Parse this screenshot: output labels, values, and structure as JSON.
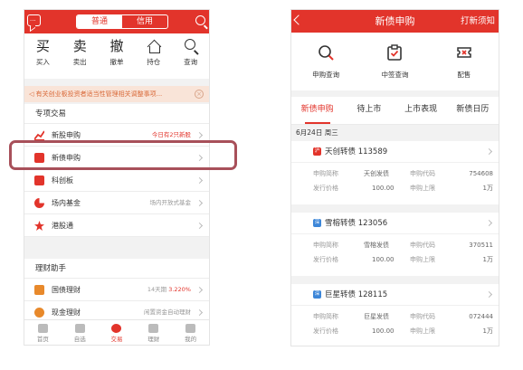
{
  "left": {
    "segments": [
      "普通",
      "信用"
    ],
    "actions": [
      {
        "big": "买",
        "label": "买入"
      },
      {
        "big": "卖",
        "label": "卖出"
      },
      {
        "big": "撤",
        "label": "撤单"
      },
      {
        "big": "",
        "label": "持仓",
        "icon": "house-icon"
      },
      {
        "big": "",
        "label": "查询",
        "icon": "search-icon"
      }
    ],
    "notice": "有关创业板投资者适当性管理相关调整事项...",
    "section1_title": "专项交易",
    "rows1": [
      {
        "label": "新股申购",
        "right": "今日有2只新股",
        "right_red": true,
        "icon": "trend-icon",
        "color": "#e2342b"
      },
      {
        "label": "新债申购",
        "right": "",
        "icon": "bond-icon",
        "color": "#e2342b"
      },
      {
        "label": "科创板",
        "right": "",
        "icon": "star-board-icon",
        "color": "#e2342b"
      },
      {
        "label": "场内基金",
        "right": "场内开放式基金",
        "icon": "pie-icon",
        "color": "#e2342b"
      },
      {
        "label": "港股通",
        "right": "",
        "icon": "bauhinia-icon",
        "color": "#e2342b"
      }
    ],
    "section2_title": "理财助手",
    "rows2": [
      {
        "label": "国债理财",
        "right_prefix": "14天期 ",
        "right_value": "3.220%",
        "icon": "ticket-icon",
        "color": "#e8892b"
      },
      {
        "label": "现金理财",
        "right": "闲置资金自动理财",
        "icon": "coin-icon",
        "color": "#e8892b"
      }
    ],
    "tabs": [
      "首页",
      "自选",
      "交易",
      "理财",
      "我的"
    ],
    "active_tab": "交易"
  },
  "right": {
    "title": "新债申购",
    "header_link": "打新须知",
    "queries": [
      {
        "label": "申购查询",
        "icon": "magnifier-icon"
      },
      {
        "label": "中签查询",
        "icon": "clipboard-check-icon"
      },
      {
        "label": "配售",
        "icon": "ticket-icon"
      }
    ],
    "tabs": [
      "新债申购",
      "待上市",
      "上市表现",
      "新债日历"
    ],
    "date": "6月24日 周三",
    "cards": [
      {
        "badge": "沪",
        "badge_color": "#e2342b",
        "name": "天创转债 113589",
        "r1": [
          "申购简称",
          "天创发债",
          "申购代码",
          "754608"
        ],
        "r2": [
          "发行价格",
          "100.00",
          "申购上限",
          "1万"
        ]
      },
      {
        "badge": "深",
        "badge_color": "#3c86d8",
        "name": "雪榕转债 123056",
        "r1": [
          "申购简称",
          "雪榕发债",
          "申购代码",
          "370511"
        ],
        "r2": [
          "发行价格",
          "100.00",
          "申购上限",
          "1万"
        ]
      },
      {
        "badge": "深",
        "badge_color": "#3c86d8",
        "name": "巨星转债 128115",
        "r1": [
          "申购简称",
          "巨星发债",
          "申购代码",
          "072444"
        ],
        "r2": [
          "发行价格",
          "100.00",
          "申购上限",
          "1万"
        ]
      }
    ]
  }
}
